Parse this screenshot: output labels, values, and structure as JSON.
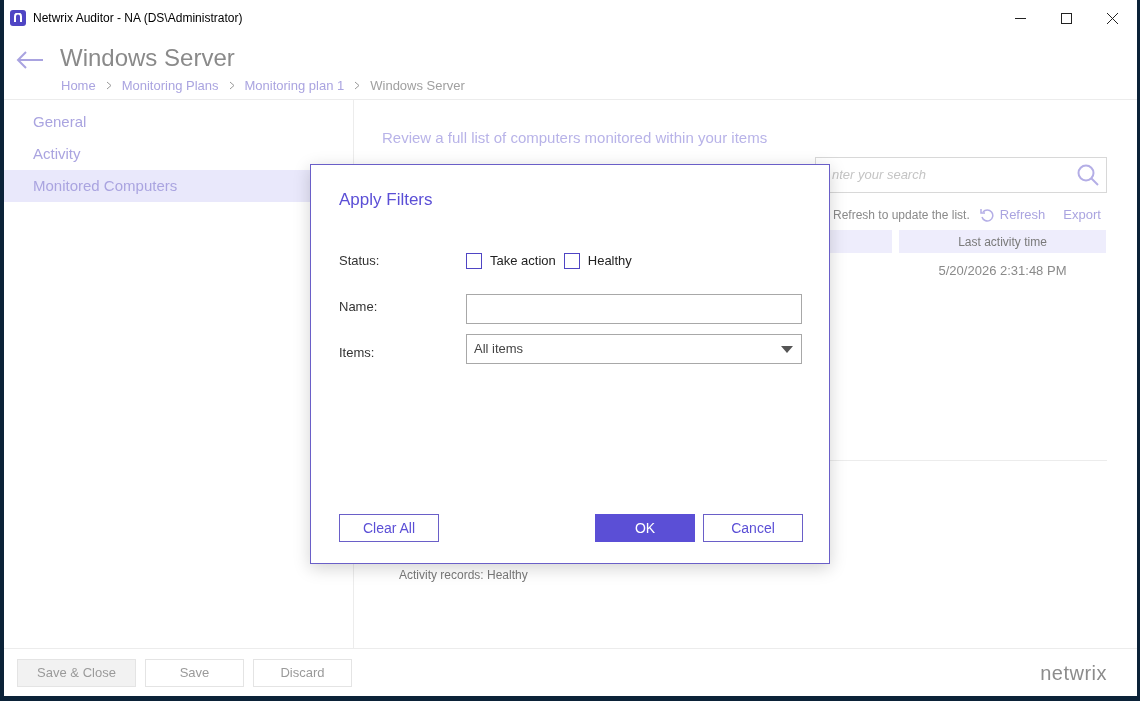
{
  "window": {
    "title": "Netwrix Auditor - NA (DS\\Administrator)"
  },
  "header": {
    "title": "Windows Server",
    "breadcrumb": [
      "Home",
      "Monitoring Plans",
      "Monitoring plan 1",
      "Windows Server"
    ]
  },
  "sidebar": {
    "items": [
      {
        "label": "General",
        "selected": false
      },
      {
        "label": "Activity",
        "selected": false
      },
      {
        "label": "Monitored Computers",
        "selected": true
      }
    ]
  },
  "content": {
    "description": "Review a full list of computers monitored within your items",
    "search": {
      "placeholder": "nter your search"
    },
    "hint": "Refresh to update the list.",
    "actions": [
      "Refresh",
      "Export"
    ],
    "table": {
      "columns": [
        "",
        "Last activity time"
      ],
      "rows": [
        [
          "",
          "5/20/2026 2:31:48 PM"
        ]
      ]
    },
    "status": "Activity records: Healthy"
  },
  "dialog": {
    "title": "Apply Filters",
    "status_label": "Status:",
    "status_options": [
      {
        "label": "Take action",
        "checked": false
      },
      {
        "label": "Healthy",
        "checked": false
      }
    ],
    "name_label": "Name:",
    "items_label": "Items:",
    "items_value": "All items",
    "buttons": [
      {
        "label": "Clear All",
        "kind": "secondary"
      },
      {
        "label": "OK",
        "kind": "primary"
      },
      {
        "label": "Cancel",
        "kind": "secondary"
      }
    ]
  },
  "footer": {
    "buttons": [
      {
        "label": "Save & Close",
        "disabled": true
      },
      {
        "label": "Save",
        "disabled": true
      },
      {
        "label": "Discard",
        "disabled": true
      }
    ],
    "logo": "netwrix"
  }
}
